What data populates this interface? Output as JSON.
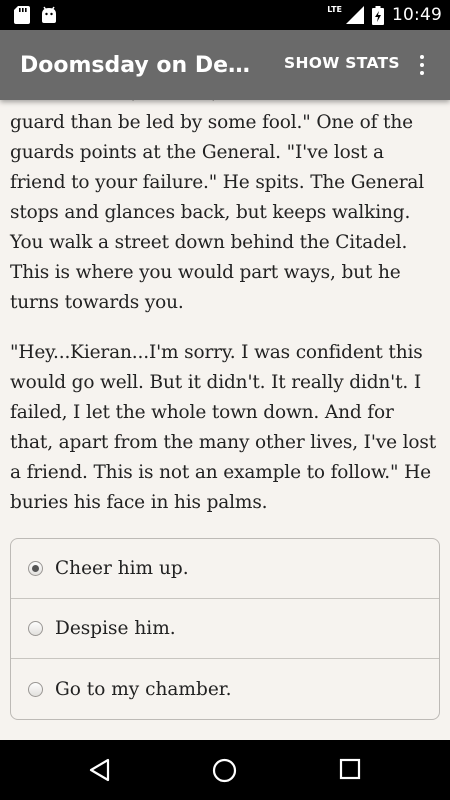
{
  "status_bar": {
    "time": "10:49",
    "network": "LTE",
    "icons": [
      "sd-card-icon",
      "android-icon",
      "signal-icon",
      "battery-icon"
    ]
  },
  "app_bar": {
    "title": "Doomsday on Demand",
    "show_stats_label": "SHOW STATS",
    "menu_icon": "overflow-menu-icon"
  },
  "story": {
    "paragraphs": [
      "mission went, I'm like, I'd rather die as a guard than be led by some fool.\" One of the guards points at the General. \"I've lost a friend to your failure.\" He spits. The General stops and glances back, but keeps walking. You walk a street down behind the Citadel. This is where you would part ways, but he turns towards you.",
      "\"Hey...Kieran...I'm sorry. I was confident this would go well. But it didn't. It really didn't. I failed, I let the whole town down. And for that, apart from the many other lives, I've lost a friend. This is not an example to follow.\" He buries his face in his palms."
    ]
  },
  "choices": [
    {
      "label": "Cheer him up.",
      "selected": true
    },
    {
      "label": "Despise him.",
      "selected": false
    },
    {
      "label": "Go to my chamber.",
      "selected": false
    }
  ],
  "nav_bar": {
    "icons": [
      "back-icon",
      "home-icon",
      "recents-icon"
    ]
  },
  "colors": {
    "app_bar": "#6a6a6a",
    "content_bg": "#f6f3ef",
    "text": "#222222"
  }
}
